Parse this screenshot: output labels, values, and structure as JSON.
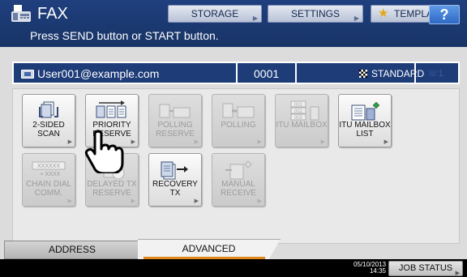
{
  "header": {
    "title": "FAX",
    "message": "Press SEND button or START button.",
    "buttons": {
      "storage": "STORAGE",
      "settings": "SETTINGS",
      "template": "TEMPLATE",
      "help": "?"
    }
  },
  "status": {
    "email": "User001@example.com",
    "count": "0001",
    "resolution": "STANDARD",
    "line": "1"
  },
  "functions": {
    "two_sided_scan": {
      "line1": "2-SIDED SCAN",
      "line2": ""
    },
    "priority_reserve": {
      "line1": "PRIORITY",
      "line2": "RESERVE"
    },
    "polling_reserve": {
      "line1": "POLLING",
      "line2": "RESERVE"
    },
    "polling": {
      "line1": "POLLING",
      "line2": ""
    },
    "itu_mailbox": {
      "line1": "ITU MAILBOX",
      "line2": ""
    },
    "itu_mailbox_list": {
      "line1": "ITU MAILBOX",
      "line2": "LIST"
    },
    "chain_dial": {
      "line1": "CHAIN DIAL",
      "line2": "COMM."
    },
    "delayed_tx_reserve": {
      "line1": "DELAYED TX",
      "line2": "RESERVE"
    },
    "recovery_tx": {
      "line1": "RECOVERY",
      "line2": "TX"
    },
    "manual_receive": {
      "line1": "MANUAL",
      "line2": "RECEIVE"
    }
  },
  "icon_text": {
    "mailbox_box_1": "001",
    "mailbox_box_2": "002",
    "mailbox_box_3": "003",
    "chain_dial_top": "XXXXXX",
    "chain_dial_bottom": "+ XXXX"
  },
  "tabs": {
    "address": "ADDRESS",
    "advanced": "ADVANCED",
    "active": "ADVANCED"
  },
  "footer": {
    "date": "05/10/2013",
    "time": "14:35",
    "job_status": "JOB STATUS"
  },
  "colors": {
    "header_bg": "#1f3f7e",
    "status_bar_bg": "#1d3c78",
    "active_tab_accent": "#e1881c",
    "help_button": "#2e69c6"
  },
  "icons": {
    "app": "fax-machine-icon",
    "template": "star-icon",
    "email": "email-icon",
    "resolution": "checkerboard-icon",
    "cursor": "hand-pointer-icon"
  }
}
